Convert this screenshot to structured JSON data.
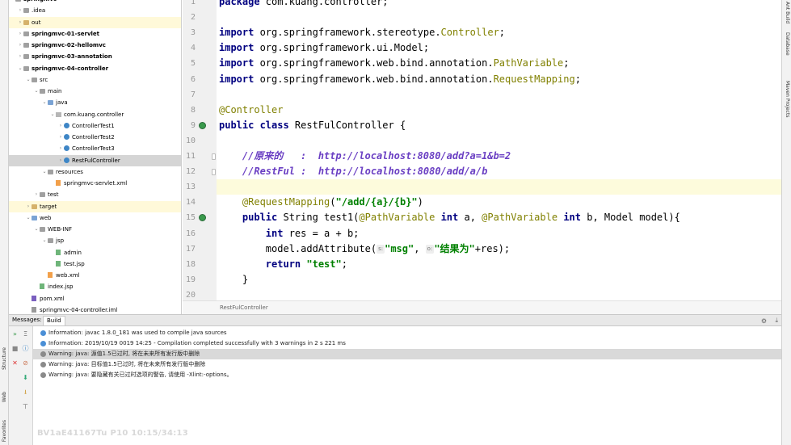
{
  "right_tabs": [
    "Ant Build",
    "Database",
    "Maven Projects"
  ],
  "left_tabs": [
    "Structure",
    "Web",
    "Favorites"
  ],
  "project_tree": [
    {
      "label": "springmvc",
      "level": 0,
      "icon": "folder-gray",
      "twisty": "down",
      "bold": true
    },
    {
      "label": ".idea",
      "level": 1,
      "icon": "folder-gray",
      "twisty": "right"
    },
    {
      "label": "out",
      "level": 1,
      "icon": "folder",
      "twisty": "right",
      "highlight": true
    },
    {
      "label": "springmvc-01-servlet",
      "level": 1,
      "icon": "folder-gray",
      "twisty": "right",
      "bold": true
    },
    {
      "label": "springmvc-02-hellomvc",
      "level": 1,
      "icon": "folder-gray",
      "twisty": "right",
      "bold": true
    },
    {
      "label": "springmvc-03-annotation",
      "level": 1,
      "icon": "folder-gray",
      "twisty": "right",
      "bold": true
    },
    {
      "label": "springmvc-04-controller",
      "level": 1,
      "icon": "folder-gray",
      "twisty": "down",
      "bold": true
    },
    {
      "label": "src",
      "level": 2,
      "icon": "folder-gray",
      "twisty": "down"
    },
    {
      "label": "main",
      "level": 3,
      "icon": "folder-gray",
      "twisty": "down"
    },
    {
      "label": "java",
      "level": 4,
      "icon": "folder-blue",
      "twisty": "down"
    },
    {
      "label": "com.kuang.controller",
      "level": 5,
      "icon": "pkg",
      "twisty": "down"
    },
    {
      "label": "ControllerTest1",
      "level": 6,
      "icon": "cls",
      "twisty": "right"
    },
    {
      "label": "ControllerTest2",
      "level": 6,
      "icon": "cls",
      "twisty": "right"
    },
    {
      "label": "ControllerTest3",
      "level": 6,
      "icon": "cls",
      "twisty": "right"
    },
    {
      "label": "RestFulController",
      "level": 6,
      "icon": "cls",
      "twisty": "right",
      "selected": true
    },
    {
      "label": "resources",
      "level": 4,
      "icon": "folder-gray",
      "twisty": "down"
    },
    {
      "label": "springmvc-servlet.xml",
      "level": 5,
      "icon": "xml",
      "twisty": ""
    },
    {
      "label": "test",
      "level": 3,
      "icon": "folder-gray",
      "twisty": "right"
    },
    {
      "label": "target",
      "level": 2,
      "icon": "folder",
      "twisty": "right",
      "highlight": true
    },
    {
      "label": "web",
      "level": 2,
      "icon": "folder-blue",
      "twisty": "down"
    },
    {
      "label": "WEB-INF",
      "level": 3,
      "icon": "folder-gray",
      "twisty": "down"
    },
    {
      "label": "jsp",
      "level": 4,
      "icon": "folder-gray",
      "twisty": "down"
    },
    {
      "label": "admin",
      "level": 5,
      "icon": "jsp",
      "twisty": ""
    },
    {
      "label": "test.jsp",
      "level": 5,
      "icon": "jsp",
      "twisty": ""
    },
    {
      "label": "web.xml",
      "level": 4,
      "icon": "xml",
      "twisty": ""
    },
    {
      "label": "index.jsp",
      "level": 3,
      "icon": "jsp",
      "twisty": ""
    },
    {
      "label": "pom.xml",
      "level": 2,
      "icon": "mvn",
      "twisty": ""
    },
    {
      "label": "springmvc-04-controller.iml",
      "level": 2,
      "icon": "iml",
      "twisty": ""
    }
  ],
  "editor": {
    "line_numbers": [
      "1",
      "2",
      "3",
      "4",
      "5",
      "6",
      "7",
      "8",
      "9",
      "10",
      "11",
      "12",
      "13",
      "14",
      "15",
      "16",
      "17",
      "18",
      "19",
      "20"
    ],
    "gutter_icons": [
      "9",
      "15"
    ],
    "lines": [
      [
        {
          "t": "package ",
          "c": "kw"
        },
        {
          "t": "com.kuang.controller;",
          "c": ""
        }
      ],
      [],
      [
        {
          "t": "import ",
          "c": "kw"
        },
        {
          "t": "org.springframework.stereotype.",
          "c": ""
        },
        {
          "t": "Controller",
          "c": "pkgc"
        },
        {
          "t": ";",
          "c": ""
        }
      ],
      [
        {
          "t": "import ",
          "c": "kw"
        },
        {
          "t": "org.springframework.ui.Model;",
          "c": ""
        }
      ],
      [
        {
          "t": "import ",
          "c": "kw"
        },
        {
          "t": "org.springframework.web.bind.annotation.",
          "c": ""
        },
        {
          "t": "PathVariable",
          "c": "pkgc"
        },
        {
          "t": ";",
          "c": ""
        }
      ],
      [
        {
          "t": "import ",
          "c": "kw"
        },
        {
          "t": "org.springframework.web.bind.annotation.",
          "c": ""
        },
        {
          "t": "RequestMapping",
          "c": "pkgc"
        },
        {
          "t": ";",
          "c": ""
        }
      ],
      [],
      [
        {
          "t": "@Controller",
          "c": "ann"
        }
      ],
      [
        {
          "t": "public class ",
          "c": "kw"
        },
        {
          "t": "RestFulController {",
          "c": ""
        }
      ],
      [],
      [
        {
          "t": "    ",
          "c": ""
        },
        {
          "t": "//原来的   :  http://localhost:8080/add?a=1&b=2",
          "c": "cmt"
        }
      ],
      [
        {
          "t": "    ",
          "c": ""
        },
        {
          "t": "//RestFul :  http://localhost:8080/add/a/b",
          "c": "cmt"
        }
      ],
      [],
      [
        {
          "t": "    ",
          "c": ""
        },
        {
          "t": "@RequestMapping",
          "c": "ann"
        },
        {
          "t": "(",
          "c": ""
        },
        {
          "t": "\"/add/{a}/{b}\"",
          "c": "str"
        },
        {
          "t": ")",
          "c": ""
        }
      ],
      [
        {
          "t": "    ",
          "c": ""
        },
        {
          "t": "public ",
          "c": "kw"
        },
        {
          "t": "String test1(",
          "c": ""
        },
        {
          "t": "@PathVariable ",
          "c": "ann"
        },
        {
          "t": "int ",
          "c": "kw"
        },
        {
          "t": "a, ",
          "c": ""
        },
        {
          "t": "@PathVariable ",
          "c": "ann"
        },
        {
          "t": "int ",
          "c": "kw"
        },
        {
          "t": "b, Model model){",
          "c": ""
        }
      ],
      [
        {
          "t": "        ",
          "c": ""
        },
        {
          "t": "int ",
          "c": "kw"
        },
        {
          "t": "res = a + b;",
          "c": ""
        }
      ],
      [
        {
          "t": "        model.addAttribute(",
          "c": ""
        },
        {
          "t": "s:",
          "c": "hint"
        },
        {
          "t": "\"msg\"",
          "c": "str"
        },
        {
          "t": ", ",
          "c": ""
        },
        {
          "t": "o:",
          "c": "hint"
        },
        {
          "t": "\"结果为\"",
          "c": "str"
        },
        {
          "t": "+res);",
          "c": ""
        }
      ],
      [
        {
          "t": "        ",
          "c": ""
        },
        {
          "t": "return ",
          "c": "kw"
        },
        {
          "t": "\"test\"",
          "c": "str"
        },
        {
          "t": ";",
          "c": ""
        }
      ],
      [
        {
          "t": "    }",
          "c": ""
        }
      ],
      []
    ],
    "breadcrumb": "RestFulController"
  },
  "messages": {
    "label": "Messages:",
    "tab": "Build",
    "items": [
      {
        "type": "info",
        "text": "Information: javac 1.8.0_181 was used to compile java sources"
      },
      {
        "type": "info",
        "text": "Information: 2019/10/19 0019 14:25 - Compilation completed successfully with 3 warnings in 2 s 221 ms"
      },
      {
        "type": "warn",
        "text": "Warning: java: 源值1.5已过时, 将在未来所有发行版中删除",
        "selected": true
      },
      {
        "type": "warn",
        "text": "Warning: java: 目标值1.5已过时, 将在未来所有发行版中删除"
      },
      {
        "type": "warn",
        "text": "Warning: java: 要隐藏有关已过时选项的警告, 请使用 -Xlint:-options。"
      }
    ]
  },
  "watermark": "BV1aE41167Tu P10 10:15/34:13"
}
